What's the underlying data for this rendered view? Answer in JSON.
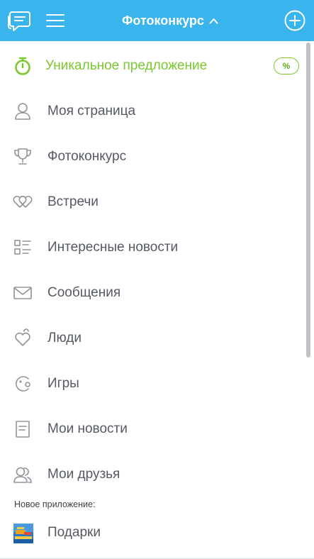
{
  "header": {
    "title": "Фотоконкурс",
    "chat_icon": "chat-bubble-icon",
    "menu_icon": "hamburger-icon",
    "add_icon": "plus-circle-icon",
    "background": "#3ab4ed"
  },
  "menu": {
    "promo": {
      "label": "Уникальное предложение",
      "icon": "stopwatch-icon",
      "badge": "%",
      "color": "#7cc72f"
    },
    "items": [
      {
        "label": "Моя страница",
        "icon": "user-icon"
      },
      {
        "label": "Фотоконкурс",
        "icon": "trophy-icon"
      },
      {
        "label": "Встречи",
        "icon": "hearts-icon"
      },
      {
        "label": "Интересные новости",
        "icon": "news-list-icon"
      },
      {
        "label": "Сообщения",
        "icon": "envelope-icon"
      },
      {
        "label": "Люди",
        "icon": "heart-hand-icon"
      },
      {
        "label": "Игры",
        "icon": "gamepad-icon"
      },
      {
        "label": "Мои новости",
        "icon": "document-icon"
      },
      {
        "label": "Мои друзья",
        "icon": "friends-icon"
      }
    ],
    "new_app_section": "Новое приложение:",
    "app": {
      "label": "Подарки",
      "icon": "gifts-app-icon"
    }
  }
}
